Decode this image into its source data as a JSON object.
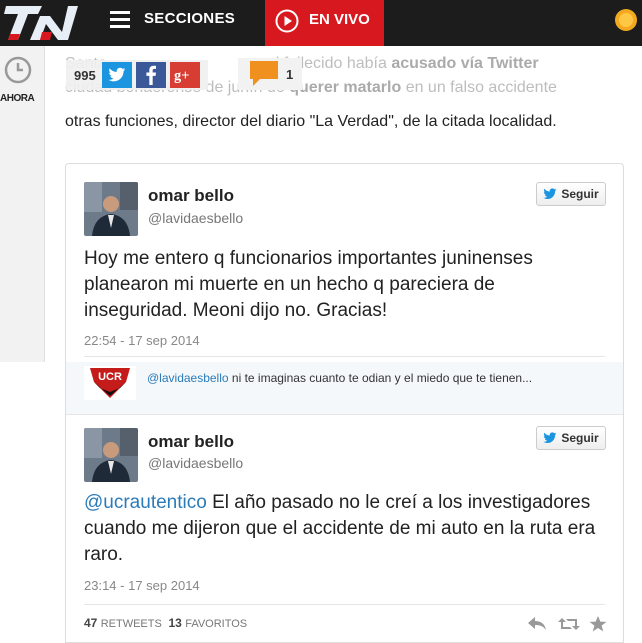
{
  "header": {
    "logo_text": "TN",
    "menu_label": "SECCIONES",
    "live_label": "EN VIVO"
  },
  "sidebar": {
    "ahora_label": "AHORA"
  },
  "share": {
    "count": "995",
    "comments": "1"
  },
  "article": {
    "line1_a": "Santa",
    "line1_b": "es, el fallecido había",
    "line1_bold": "acusado vía Twitter",
    "line2_a": "ciudad bonaerense de junín de",
    "line2_bold": "querer matarlo",
    "line2_b": "en un falso accidente",
    "line3": "otras funciones, director del diario \"La Verdad\", de la citada localidad."
  },
  "tweet1": {
    "name": "omar bello",
    "handle": "@lavidaesbello",
    "follow": "Seguir",
    "text": "Hoy me entero q funcionarios importantes juninenses planearon mi muerte en un hecho q pareciera de inseguridad. Meoni dijo no. Gracias!",
    "time": "22:54 - 17 sep 2014"
  },
  "reply": {
    "mention": "@lavidaesbello",
    "text": "ni te imaginas cuanto te odian y el miedo que te tienen..."
  },
  "tweet2": {
    "name": "omar bello",
    "handle": "@lavidaesbello",
    "follow": "Seguir",
    "mention": "@ucrautentico",
    "text": "El año pasado no le creí a los investigadores cuando me dijeron que el accidente de mi auto en la ruta era raro.",
    "time": "23:14 - 17 sep 2014",
    "retweets": "47",
    "retweets_label": "RETWEETS",
    "favorites": "13",
    "favorites_label": "FAVORITOS"
  },
  "colors": {
    "brand_red": "#d7191f",
    "twitter_blue": "#1b95e0",
    "facebook": "#3b5998",
    "gplus": "#d73d32",
    "comment_orange": "#f0901e"
  },
  "icons": [
    "menu-icon",
    "play-icon",
    "clock-icon",
    "twitter-icon",
    "facebook-icon",
    "google-plus-icon",
    "comment-icon",
    "reply-icon",
    "retweet-icon",
    "favorite-icon"
  ]
}
